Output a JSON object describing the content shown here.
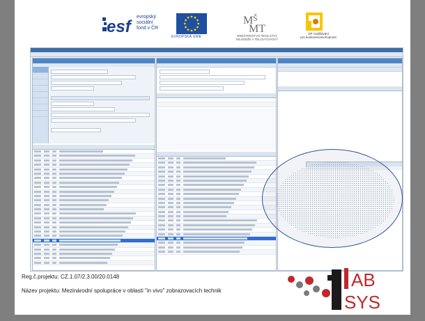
{
  "logos": {
    "esf": {
      "big": "esf",
      "lines": [
        "evropský",
        "sociální",
        "fond v ČR"
      ]
    },
    "eu": {
      "caption": "EVROPSKÁ UNIE"
    },
    "msmt": {
      "big": "MŠMT",
      "caption": [
        "MINISTERSTVO ŠKOLSTVÍ,",
        "MLÁDEŽE A TĚLOVÝCHOVY"
      ]
    },
    "op": {
      "caption": [
        "OP Vzdělávání",
        "pro konkurenceschopnost"
      ]
    },
    "lab": {
      "text": "LAB SYS"
    }
  },
  "colors": {
    "brand_blue": "#1d3f8f",
    "lab_red": "#c0282d",
    "selection_blue": "#2f6fd0",
    "ellipse": "#2f5597"
  },
  "footer": {
    "line1": "Reg.č.projektu: CZ.1.07/2.3.00/20.0148",
    "line2": "Název projektu: Mezinárodní spolupráce v oblasti \"in vivo\" zobrazovacích technik"
  }
}
